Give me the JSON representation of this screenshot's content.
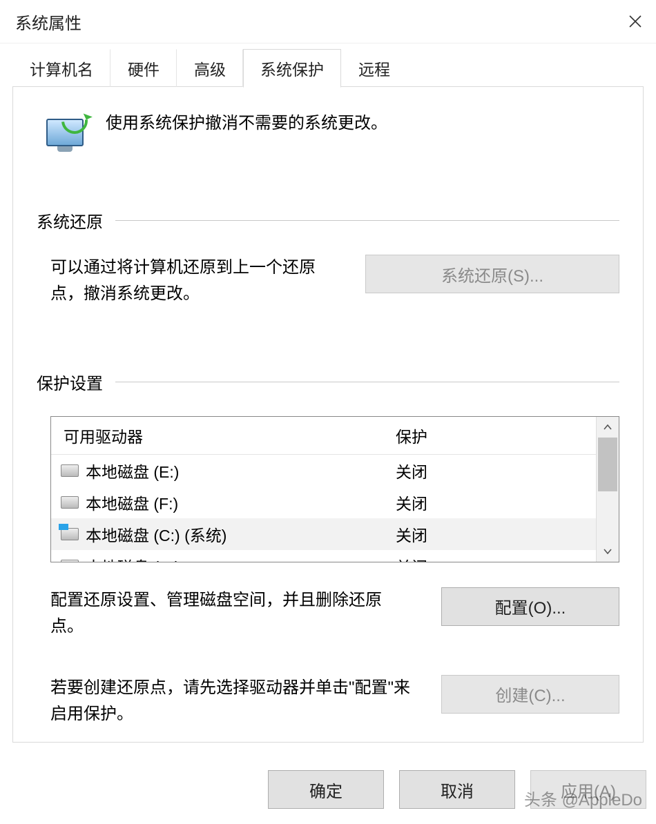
{
  "window": {
    "title": "系统属性"
  },
  "tabs": {
    "computer_name": "计算机名",
    "hardware": "硬件",
    "advanced": "高级",
    "system_protection": "系统保护",
    "remote": "远程"
  },
  "intro_text": "使用系统保护撤消不需要的系统更改。",
  "sections": {
    "restore": {
      "heading": "系统还原",
      "desc": "可以通过将计算机还原到上一个还原点，撤消系统更改。",
      "button": "系统还原(S)..."
    },
    "protection": {
      "heading": "保护设置",
      "columns": {
        "drive": "可用驱动器",
        "protection": "保护"
      },
      "drives": [
        {
          "label": "本地磁盘 (E:)",
          "status": "关闭",
          "system": false,
          "selected": false
        },
        {
          "label": "本地磁盘 (F:)",
          "status": "关闭",
          "system": false,
          "selected": false
        },
        {
          "label": "本地磁盘 (C:) (系统)",
          "status": "关闭",
          "system": true,
          "selected": true
        },
        {
          "label": "本地磁盘 (D:)",
          "status": "关闭",
          "system": false,
          "selected": false
        }
      ],
      "configure_desc": "配置还原设置、管理磁盘空间，并且删除还原点。",
      "configure_button": "配置(O)...",
      "create_desc": "若要创建还原点，请先选择驱动器并单击\"配置\"来启用保护。",
      "create_button": "创建(C)..."
    }
  },
  "footer": {
    "ok": "确定",
    "cancel": "取消",
    "apply": "应用(A)"
  },
  "watermark": "头条 @AppleDo"
}
